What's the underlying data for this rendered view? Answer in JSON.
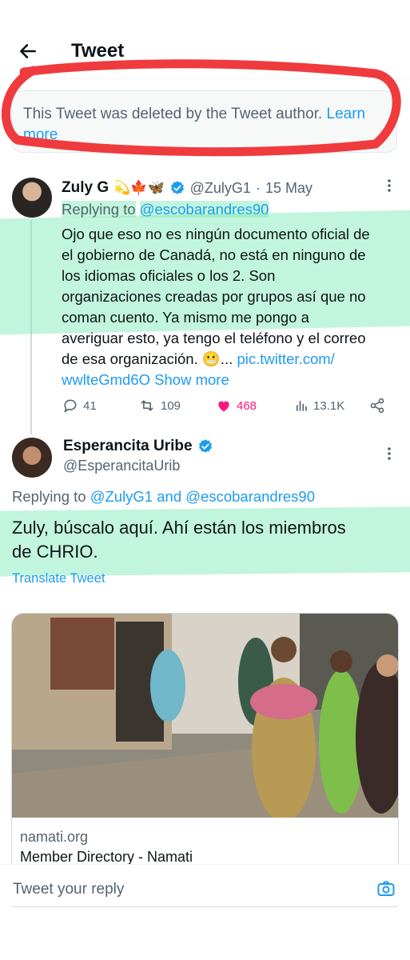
{
  "header": {
    "title": "Tweet"
  },
  "deleted_notice": {
    "text": "This Tweet was deleted by the Tweet author.",
    "link": "Learn more"
  },
  "tweet1": {
    "name": "Zuly G",
    "emojis": "💫🍁🦋",
    "handle": "@ZulyG1",
    "date": "15 May",
    "replying_to_label": "Replying to",
    "replying_to": "@escobarandres90",
    "lines": [
      "Ojo que eso no es ningún documento oficial de",
      "el gobierno de Canadá, no está en ninguno de",
      "los idiomas oficiales o los 2. Son",
      "organizaciones creadas por grupos así que no",
      "coman cuento. Ya mismo me pongo a",
      "averiguar esto, ya tengo el teléfono y el correo"
    ],
    "line7_text": "de esa organización. 😬...",
    "line7_link": "pic.twitter.com/",
    "link_line": "wwlteGmd6O",
    "show_more": "Show more",
    "replies": "41",
    "retweets": "109",
    "likes": "468",
    "views": "13.1K"
  },
  "tweet2": {
    "name": "Esperancita Uribe",
    "handle": "@EsperancitaUrib",
    "replying_to_label": "Replying to",
    "replying_to": "@ZulyG1 and @escobarandres90",
    "lines": [
      "Zuly, búscalo aquí. Ahí están los miembros",
      "de CHRIO."
    ],
    "translate": "Translate Tweet",
    "card": {
      "domain": "namati.org",
      "title": "Member Directory - Namati"
    }
  },
  "reply_box": {
    "placeholder": "Tweet your reply"
  },
  "colors": {
    "link": "#1d9bf0",
    "like": "#f91880",
    "verified": "#1d9bf0",
    "marker": "#ef3b3e"
  }
}
